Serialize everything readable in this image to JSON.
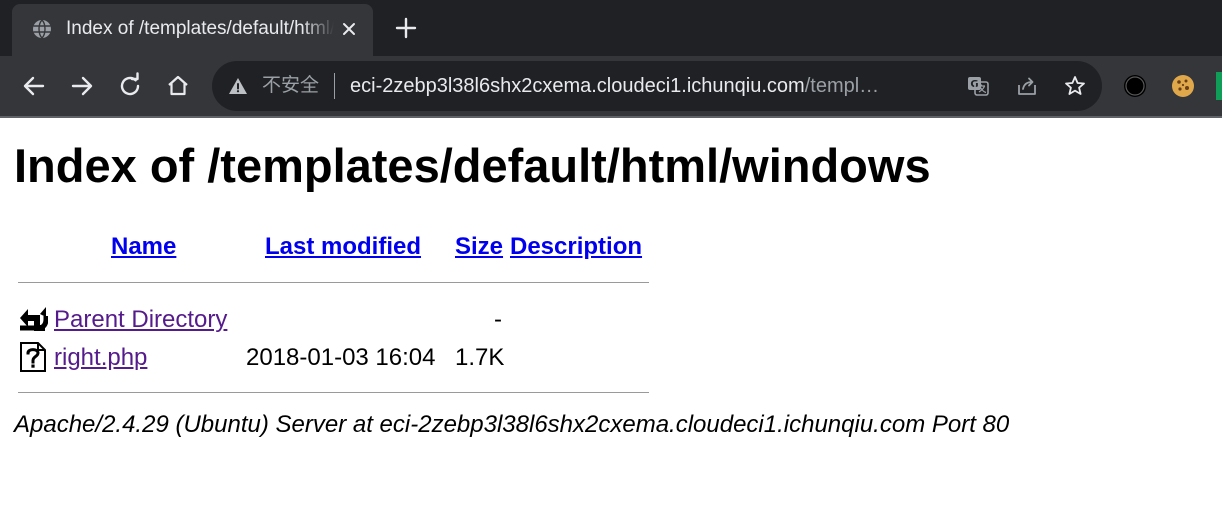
{
  "tab": {
    "title": "Index of /templates/default/html/windows",
    "close_icon": "close-icon",
    "favicon": "globe-icon"
  },
  "newtab": {
    "icon": "plus-icon"
  },
  "toolbar": {
    "back_icon": "back-arrow-icon",
    "forward_icon": "forward-arrow-icon",
    "reload_icon": "reload-icon",
    "home_icon": "home-icon"
  },
  "omnibox": {
    "security_label": "不安全",
    "security_icon": "warning-triangle-icon",
    "host": "eci-2zebp3l38l6shx2cxema.cloudeci1.ichunqiu.com",
    "path": "/templ…",
    "translate_icon": "translate-icon",
    "share_icon": "share-icon",
    "bookmark_icon": "star-icon"
  },
  "extensions": [
    "record-icon",
    "cookie-icon"
  ],
  "page": {
    "heading": "Index of /templates/default/html/windows",
    "columns": {
      "name": "Name",
      "last_modified": "Last modified",
      "size": "Size",
      "description": "Description"
    },
    "rows": [
      {
        "icon": "parent-directory-icon",
        "name": "Parent Directory",
        "last_modified": "",
        "size": "-",
        "description": ""
      },
      {
        "icon": "unknown-file-icon",
        "name": "right.php",
        "last_modified": "2018-01-03 16:04",
        "size": "1.7K",
        "description": ""
      }
    ],
    "footer": "Apache/2.4.29 (Ubuntu) Server at eci-2zebp3l38l6shx2cxema.cloudeci1.ichunqiu.com Port 80"
  },
  "colors": {
    "tabstrip_bg": "#202124",
    "toolbar_bg": "#35363a",
    "link_unvisited": "#0000ee",
    "link_visited": "#551a8b"
  }
}
